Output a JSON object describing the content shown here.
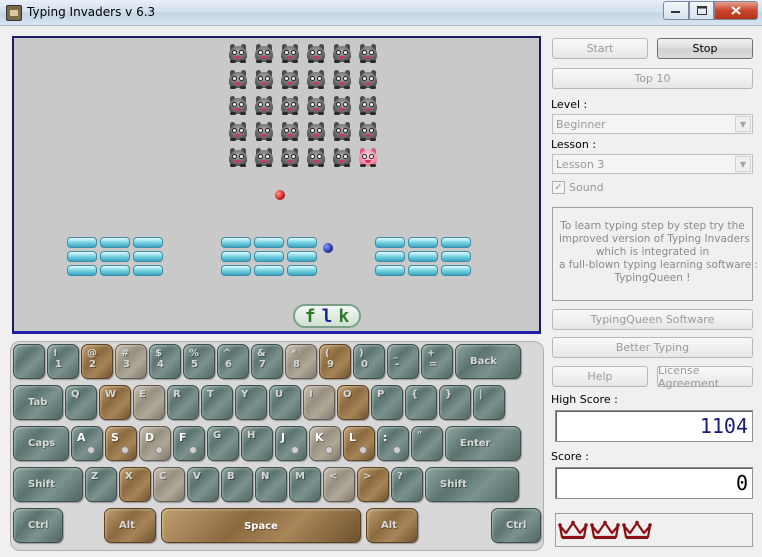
{
  "window": {
    "title": "Typing Invaders v 6.3"
  },
  "controls": {
    "start": "Start",
    "stop": "Stop",
    "top10": "Top 10",
    "level_label": "Level :",
    "level_value": "Beginner",
    "lesson_label": "Lesson :",
    "lesson_value": "Lesson 3",
    "sound_label": "Sound",
    "sound_checked": true,
    "info_lines": [
      "To learn typing step by step try the",
      "improved version of Typing Invaders",
      "which is integrated in",
      "a full-blown typing learning software :",
      "TypingQueen !"
    ],
    "typingqueen": "TypingQueen Software",
    "better_typing": "Better Typing",
    "help": "Help",
    "license": "License Agreement",
    "high_score_label": "High Score :",
    "high_score": "1104",
    "score_label": "Score :",
    "score": "0",
    "lives": 3
  },
  "game": {
    "word": [
      "f",
      "l",
      "k"
    ],
    "invader_rows": 5,
    "invader_cols": 6,
    "pink_invader": {
      "row": 4,
      "col": 5
    }
  },
  "keyboard": {
    "row1": [
      {
        "top": "",
        "bottom": "",
        "color": "grey"
      },
      {
        "top": "!",
        "bottom": "1",
        "color": "grey"
      },
      {
        "top": "@",
        "bottom": "2",
        "color": "brown"
      },
      {
        "top": "#",
        "bottom": "3",
        "color": "tan"
      },
      {
        "top": "$",
        "bottom": "4",
        "color": "grey"
      },
      {
        "top": "%",
        "bottom": "5",
        "color": "grey"
      },
      {
        "top": "^",
        "bottom": "6",
        "color": "grey"
      },
      {
        "top": "&",
        "bottom": "7",
        "color": "grey"
      },
      {
        "top": "*",
        "bottom": "8",
        "color": "tan"
      },
      {
        "top": "(",
        "bottom": "9",
        "color": "brown"
      },
      {
        "top": ")",
        "bottom": "0",
        "color": "grey"
      },
      {
        "top": "_",
        "bottom": "-",
        "color": "grey"
      },
      {
        "top": "+",
        "bottom": "=",
        "color": "grey"
      },
      {
        "top": "Back",
        "bottom": "",
        "color": "grey"
      }
    ],
    "row2": [
      {
        "label": "Tab",
        "color": "grey"
      },
      {
        "label": "Q",
        "color": "grey"
      },
      {
        "label": "W",
        "color": "brown"
      },
      {
        "label": "E",
        "color": "tan"
      },
      {
        "label": "R",
        "color": "grey"
      },
      {
        "label": "T",
        "color": "grey"
      },
      {
        "label": "Y",
        "color": "grey"
      },
      {
        "label": "U",
        "color": "grey"
      },
      {
        "label": "I",
        "color": "tan"
      },
      {
        "label": "O",
        "color": "brown"
      },
      {
        "label": "P",
        "color": "grey"
      },
      {
        "label": "{",
        "color": "grey"
      },
      {
        "label": "}",
        "color": "grey"
      },
      {
        "label": "|",
        "color": "grey"
      }
    ],
    "row3": [
      {
        "label": "Caps",
        "color": "grey"
      },
      {
        "label": "A",
        "color": "grey",
        "home": true
      },
      {
        "label": "S",
        "color": "brown",
        "home": true
      },
      {
        "label": "D",
        "color": "tan",
        "home": true
      },
      {
        "label": "F",
        "color": "grey",
        "home": true
      },
      {
        "label": "G",
        "color": "grey"
      },
      {
        "label": "H",
        "color": "grey"
      },
      {
        "label": "J",
        "color": "grey",
        "home": true
      },
      {
        "label": "K",
        "color": "tan",
        "home": true
      },
      {
        "label": "L",
        "color": "brown",
        "home": true
      },
      {
        "label": ":",
        "color": "grey",
        "home": true
      },
      {
        "label": "\"",
        "color": "grey"
      },
      {
        "label": "Enter",
        "color": "grey"
      }
    ],
    "row4": [
      {
        "label": "Shift",
        "color": "grey"
      },
      {
        "label": "Z",
        "color": "grey"
      },
      {
        "label": "X",
        "color": "brown"
      },
      {
        "label": "C",
        "color": "tan"
      },
      {
        "label": "V",
        "color": "grey"
      },
      {
        "label": "B",
        "color": "grey"
      },
      {
        "label": "N",
        "color": "grey"
      },
      {
        "label": "M",
        "color": "grey"
      },
      {
        "label": "<",
        "color": "tan"
      },
      {
        "label": ">",
        "color": "brown"
      },
      {
        "label": "?",
        "color": "grey"
      },
      {
        "label": "Shift",
        "color": "grey"
      }
    ],
    "row5": [
      {
        "label": "Ctrl",
        "color": "grey"
      },
      {
        "label": "Alt",
        "color": "brown"
      },
      {
        "label": "Space",
        "color": "brown"
      },
      {
        "label": "Alt",
        "color": "brown"
      },
      {
        "label": "Ctrl",
        "color": "grey"
      }
    ]
  },
  "colors": {
    "field_bg": "#c9c9c9",
    "field_border": "#1a1a6a",
    "high_score_text": "#1a1a7a",
    "crown": "#8b1010"
  }
}
